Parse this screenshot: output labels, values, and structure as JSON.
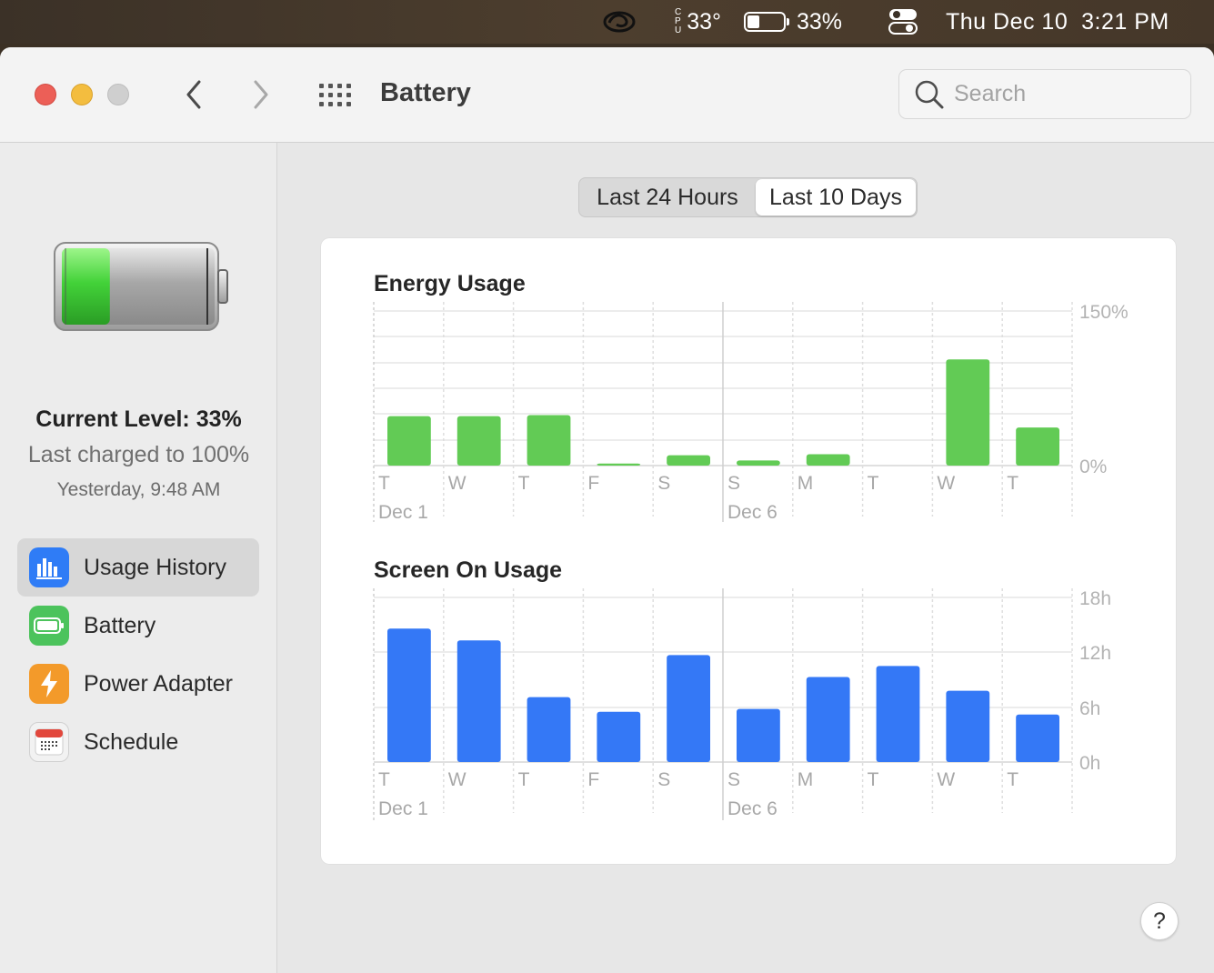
{
  "menubar": {
    "cpu_label": [
      "C",
      "P",
      "U"
    ],
    "cpu_temp": "33°",
    "battery_percent": "33%",
    "battery_level": 0.33,
    "clock": "Thu Dec 10  3:21 PM"
  },
  "toolbar": {
    "title": "Battery",
    "search_placeholder": "Search"
  },
  "sidebar": {
    "current_level": "Current Level: 33%",
    "last_charged": "Last charged to 100%",
    "charged_time": "Yesterday, 9:48 AM",
    "battery_fill": 0.33,
    "items": [
      {
        "label": "Usage History",
        "icon": "bar-chart-icon",
        "color": "#2f7cf6",
        "active": true
      },
      {
        "label": "Battery",
        "icon": "battery-icon",
        "color": "#4cc35c",
        "active": false
      },
      {
        "label": "Power Adapter",
        "icon": "lightning-icon",
        "color": "#f39a2a",
        "active": false
      },
      {
        "label": "Schedule",
        "icon": "calendar-icon",
        "color": "#e8e8e8",
        "active": false
      }
    ]
  },
  "segmented": {
    "options": [
      "Last 24 Hours",
      "Last 10 Days"
    ],
    "selected": 1
  },
  "chart_data": [
    {
      "type": "bar",
      "title": "Energy Usage",
      "categories": [
        "T",
        "W",
        "T",
        "F",
        "S",
        "S",
        "M",
        "T",
        "W",
        "T"
      ],
      "date_labels": [
        {
          "index": 0,
          "label": "Dec 1"
        },
        {
          "index": 5,
          "label": "Dec 6"
        }
      ],
      "values": [
        48,
        48,
        49,
        2,
        10,
        5,
        11,
        0,
        103,
        37
      ],
      "ylim": [
        0,
        150
      ],
      "ytick_labels": [
        "150%",
        "0%"
      ],
      "color": "#62cb55",
      "grid": true
    },
    {
      "type": "bar",
      "title": "Screen On Usage",
      "categories": [
        "T",
        "W",
        "T",
        "F",
        "S",
        "S",
        "M",
        "T",
        "W",
        "T"
      ],
      "date_labels": [
        {
          "index": 0,
          "label": "Dec 1"
        },
        {
          "index": 5,
          "label": "Dec 6"
        }
      ],
      "values": [
        14.6,
        13.3,
        7.1,
        5.5,
        11.7,
        5.8,
        9.3,
        10.5,
        7.8,
        5.2
      ],
      "ylim": [
        0,
        18
      ],
      "ytick_labels": [
        "18h",
        "12h",
        "6h",
        "0h"
      ],
      "color": "#3478f6",
      "grid": true
    }
  ],
  "help_label": "?"
}
